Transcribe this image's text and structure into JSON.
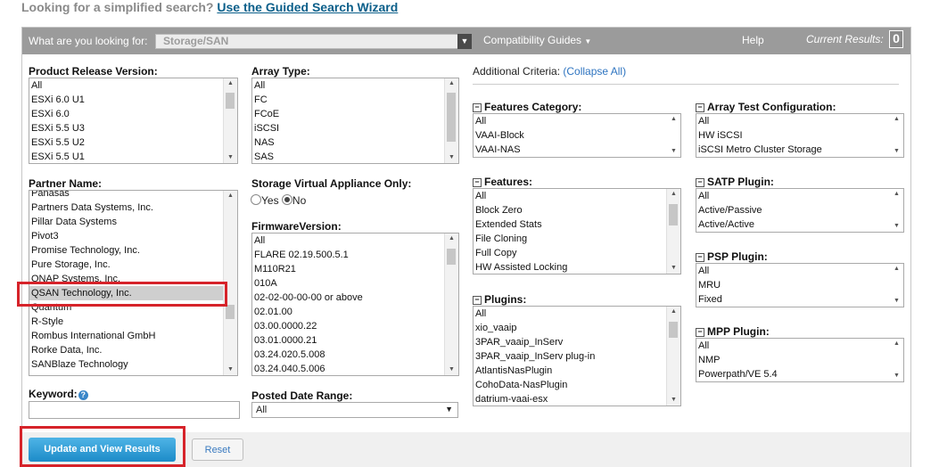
{
  "header": {
    "prompt": "Looking for a simplified search?",
    "link": "Use the Guided Search Wizard"
  },
  "topbar": {
    "looking_for_label": "What are you looking for:",
    "looking_for_value": "Storage/SAN",
    "compat_guides": "Compatibility Guides",
    "help": "Help",
    "current_results_label": "Current Results:",
    "current_results_value": "0"
  },
  "product_release": {
    "label": "Product Release Version:",
    "items": [
      "All",
      "ESXi 6.0 U1",
      "ESXi 6.0",
      "ESXi 5.5 U3",
      "ESXi 5.5 U2",
      "ESXi 5.5 U1"
    ]
  },
  "array_type": {
    "label": "Array Type:",
    "items": [
      "All",
      "FC",
      "FCoE",
      "iSCSI",
      "NAS",
      "SAS"
    ]
  },
  "partner": {
    "label": "Partner Name:",
    "items": [
      "Panasas",
      "Partners Data Systems, Inc.",
      "Pillar Data Systems",
      "Pivot3",
      "Promise Technology, Inc.",
      "Pure Storage, Inc.",
      "QNAP Systems, Inc.",
      "QSAN Technology, Inc.",
      "Quantum",
      "R-Style",
      "Rombus International GmbH",
      "Rorke Data, Inc.",
      "SANBlaze Technology"
    ],
    "selected": "QSAN Technology, Inc."
  },
  "sva": {
    "label": "Storage Virtual Appliance Only:",
    "yes": "Yes",
    "no": "No"
  },
  "firmware": {
    "label": "FirmwareVersion:",
    "items": [
      "All",
      "FLARE 02.19.500.5.1",
      "M110R21",
      "010A",
      "02-02-00-00-00 or above",
      "02.01.00",
      "03.00.0000.22",
      "03.01.0000.21",
      "03.24.020.5.008",
      "03.24.040.5.006"
    ]
  },
  "keyword": {
    "label": "Keyword:",
    "value": ""
  },
  "posted_date": {
    "label": "Posted Date Range:",
    "value": "All"
  },
  "additional": {
    "label": "Additional Criteria:",
    "collapse": "(Collapse All)"
  },
  "features_category": {
    "label": "Features Category:",
    "items": [
      "All",
      "VAAI-Block",
      "VAAI-NAS"
    ]
  },
  "features": {
    "label": "Features:",
    "items": [
      "All",
      "Block Zero",
      "Extended Stats",
      "File Cloning",
      "Full Copy",
      "HW Assisted Locking"
    ]
  },
  "plugins": {
    "label": "Plugins:",
    "items": [
      "All",
      "xio_vaaip",
      "3PAR_vaaip_InServ",
      "3PAR_vaaip_InServ plug-in",
      "AtlantisNasPlugin",
      "CohoData-NasPlugin",
      "datrium-vaai-esx"
    ]
  },
  "array_test": {
    "label": "Array Test Configuration:",
    "items": [
      "All",
      "HW iSCSI",
      "iSCSI Metro Cluster Storage"
    ]
  },
  "satp": {
    "label": "SATP Plugin:",
    "items": [
      "All",
      "Active/Passive",
      "Active/Active"
    ]
  },
  "psp": {
    "label": "PSP Plugin:",
    "items": [
      "All",
      "MRU",
      "Fixed"
    ]
  },
  "mpp": {
    "label": "MPP Plugin:",
    "items": [
      "All",
      "NMP",
      "Powerpath/VE 5.4"
    ]
  },
  "buttons": {
    "update": "Update and View Results",
    "reset": "Reset"
  },
  "colors": {
    "topbar": "#9b9b9b",
    "highlight_border": "#d6232a",
    "link": "#0b5f8a",
    "button": "#1c8bc8"
  }
}
